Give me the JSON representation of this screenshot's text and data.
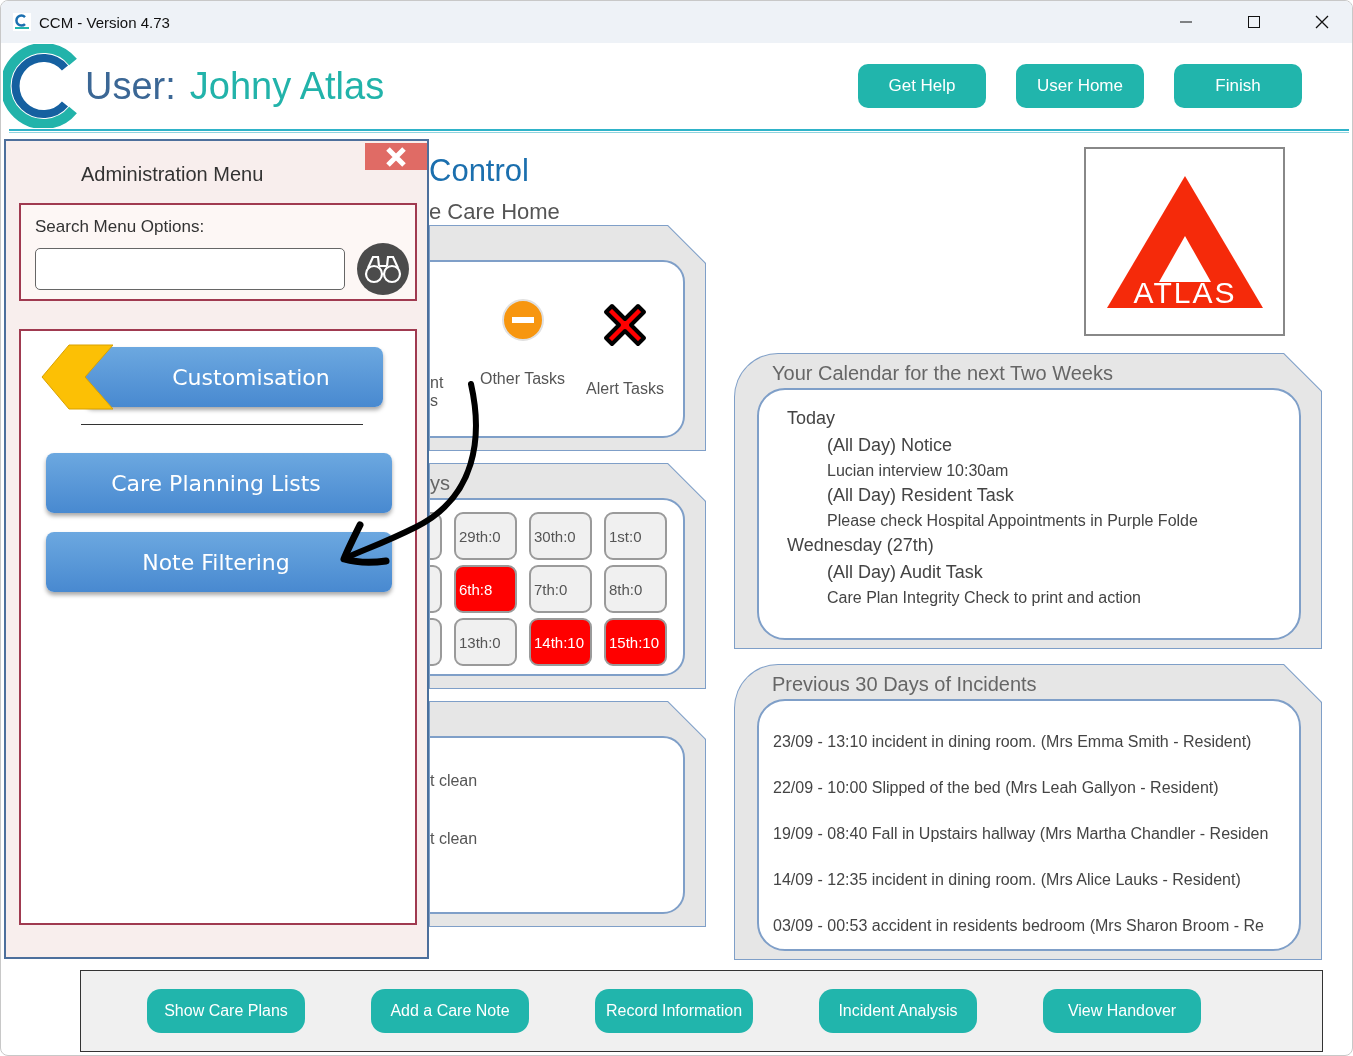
{
  "window": {
    "title": "CCM - Version 4.73"
  },
  "header": {
    "user_label": "User:",
    "user_name": "Johny Atlas",
    "buttons": [
      "Get Help",
      "User Home",
      "Finish"
    ]
  },
  "dashboard": {
    "title": "Control",
    "subtitle": "e Care Home",
    "tasks": [
      {
        "kind": "cut",
        "label_lines": [
          "nt",
          "s"
        ]
      },
      {
        "kind": "minus",
        "label_lines": [
          "Other Tasks"
        ]
      },
      {
        "kind": "cross",
        "label_lines": [
          "Alert Tasks"
        ]
      }
    ],
    "dates_heading": "ys",
    "dates": [
      [
        {
          "label": "29th:0",
          "alert": false
        },
        {
          "label": "30th:0",
          "alert": false
        },
        {
          "label": "1st:0",
          "alert": false
        }
      ],
      [
        {
          "label": "6th:8",
          "alert": true
        },
        {
          "label": "7th:0",
          "alert": false
        },
        {
          "label": "8th:0",
          "alert": false
        }
      ],
      [
        {
          "label": "13th:0",
          "alert": false
        },
        {
          "label": "14th:10",
          "alert": true
        },
        {
          "label": "15th:10",
          "alert": true
        }
      ]
    ],
    "cleaning": [
      "t clean",
      "t clean"
    ]
  },
  "logo": {
    "text": "ATLAS"
  },
  "calendar": {
    "title": "Your Calendar for the next Two Weeks",
    "entries": [
      {
        "kind": "day",
        "text": "Today"
      },
      {
        "kind": "title",
        "text": "(All Day) Notice"
      },
      {
        "kind": "detail",
        "text": "Lucian interview 10:30am"
      },
      {
        "kind": "title",
        "text": "(All Day) Resident Task"
      },
      {
        "kind": "detail",
        "text": "Please check Hospital Appointments in Purple Folde"
      },
      {
        "kind": "day",
        "text": "Wednesday (27th)"
      },
      {
        "kind": "title",
        "text": "(All Day) Audit Task"
      },
      {
        "kind": "detail",
        "text": "Care Plan Integrity Check to print and action"
      }
    ]
  },
  "incidents": {
    "title": "Previous 30 Days of Incidents",
    "items": [
      "23/09 - 13:10 incident in dining room. (Mrs Emma Smith - Resident)",
      "22/09 - 10:00 Slipped of the bed (Mrs Leah Gallyon - Resident)",
      "19/09 - 08:40 Fall in Upstairs hallway (Mrs Martha Chandler - Residen",
      "14/09 - 12:35 incident in dining room. (Mrs Alice Lauks - Resident)",
      "03/09 - 00:53 accident in residents bedroom (Mrs Sharon Broom - Re"
    ]
  },
  "admin_menu": {
    "title": "Administration Menu",
    "search_label": "Search Menu Options:",
    "items": [
      {
        "kind": "back",
        "label": "Customisation"
      },
      {
        "kind": "divider"
      },
      {
        "kind": "item",
        "label": "Care Planning Lists"
      },
      {
        "kind": "item",
        "label": "Note Filtering"
      }
    ]
  },
  "bottom_bar": {
    "buttons": [
      "Show Care Plans",
      "Add a Care Note",
      "Record Information",
      "Incident Analysis",
      "View Handover"
    ]
  }
}
